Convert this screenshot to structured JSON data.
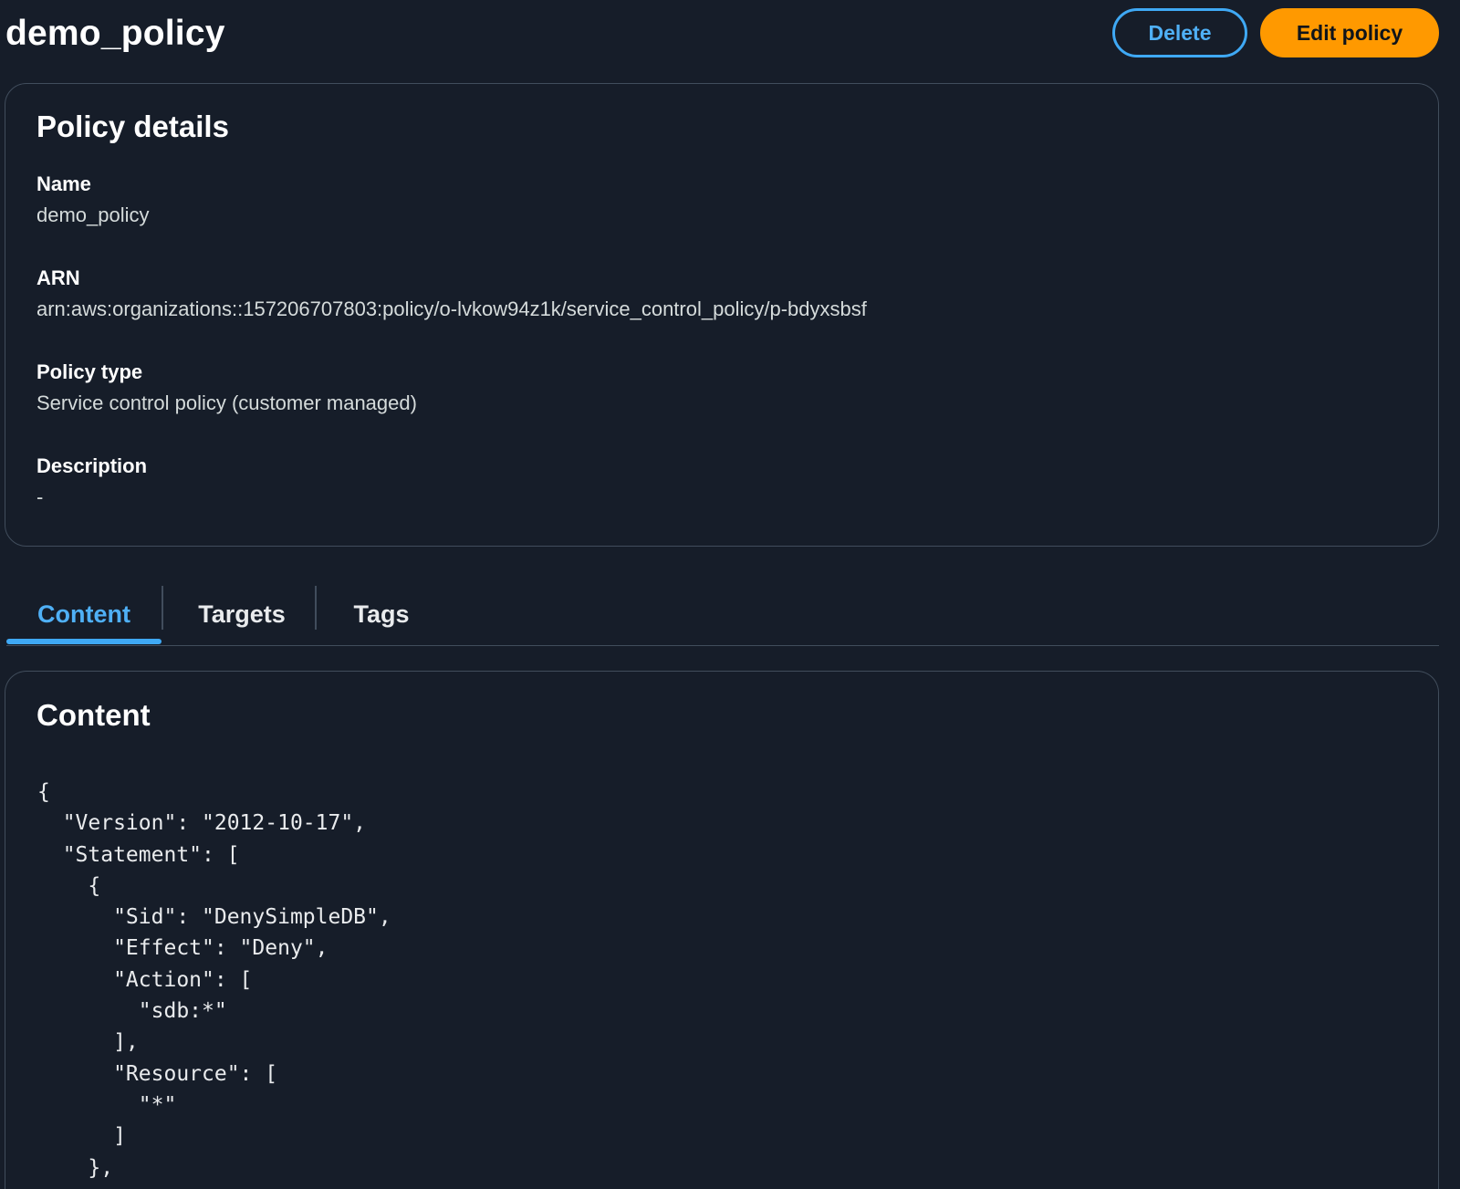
{
  "header": {
    "title": "demo_policy",
    "delete_label": "Delete",
    "edit_label": "Edit policy"
  },
  "details": {
    "title": "Policy details",
    "fields": [
      {
        "label": "Name",
        "value": "demo_policy"
      },
      {
        "label": "ARN",
        "value": "arn:aws:organizations::157206707803:policy/o-lvkow94z1k/service_control_policy/p-bdyxsbsf"
      },
      {
        "label": "Policy type",
        "value": "Service control policy (customer managed)"
      },
      {
        "label": "Description",
        "value": "-"
      }
    ]
  },
  "tabs": [
    {
      "label": "Content",
      "active": true
    },
    {
      "label": "Targets",
      "active": false
    },
    {
      "label": "Tags",
      "active": false
    }
  ],
  "content": {
    "title": "Content",
    "policy_json": "{\n  \"Version\": \"2012-10-17\",\n  \"Statement\": [\n    {\n      \"Sid\": \"DenySimpleDB\",\n      \"Effect\": \"Deny\",\n      \"Action\": [\n        \"sdb:*\"\n      ],\n      \"Resource\": [\n        \"*\"\n      ]\n    },\n    {"
  },
  "colors": {
    "background": "#161d29",
    "accent_blue": "#3fa9f5",
    "primary_orange": "#ff9900",
    "border": "#414d5c"
  }
}
